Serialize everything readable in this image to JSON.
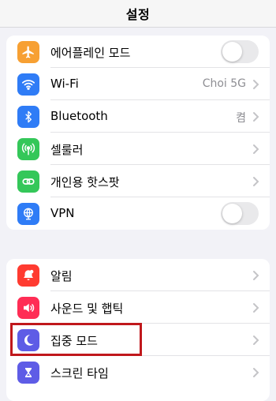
{
  "header": {
    "title": "설정"
  },
  "group1": [
    {
      "label": "에어플레인 모드",
      "icon": "airplane-icon",
      "color": "#f7a033",
      "control": "toggle",
      "toggle_on": false
    },
    {
      "label": "Wi-Fi",
      "icon": "wifi-icon",
      "color": "#2f7cf6",
      "value": "Choi 5G"
    },
    {
      "label": "Bluetooth",
      "icon": "bluetooth-icon",
      "color": "#2f7cf6",
      "value": "켬"
    },
    {
      "label": "셀룰러",
      "icon": "cellular-icon",
      "color": "#34c759"
    },
    {
      "label": "개인용 핫스팟",
      "icon": "hotspot-icon",
      "color": "#34c759"
    },
    {
      "label": "VPN",
      "icon": "vpn-icon",
      "color": "#2f7cf6",
      "control": "toggle",
      "toggle_on": false
    }
  ],
  "group2": [
    {
      "label": "알림",
      "icon": "notifications-icon",
      "color": "#ff3b30"
    },
    {
      "label": "사운드 및 햅틱",
      "icon": "sound-icon",
      "color": "#ff2d55"
    },
    {
      "label": "집중 모드",
      "icon": "focus-moon-icon",
      "color": "#5e5ce6",
      "highlighted": true
    },
    {
      "label": "스크린 타임",
      "icon": "hourglass-icon",
      "color": "#5e5ce6"
    }
  ],
  "colors": {
    "highlight_border": "#c0181c"
  }
}
